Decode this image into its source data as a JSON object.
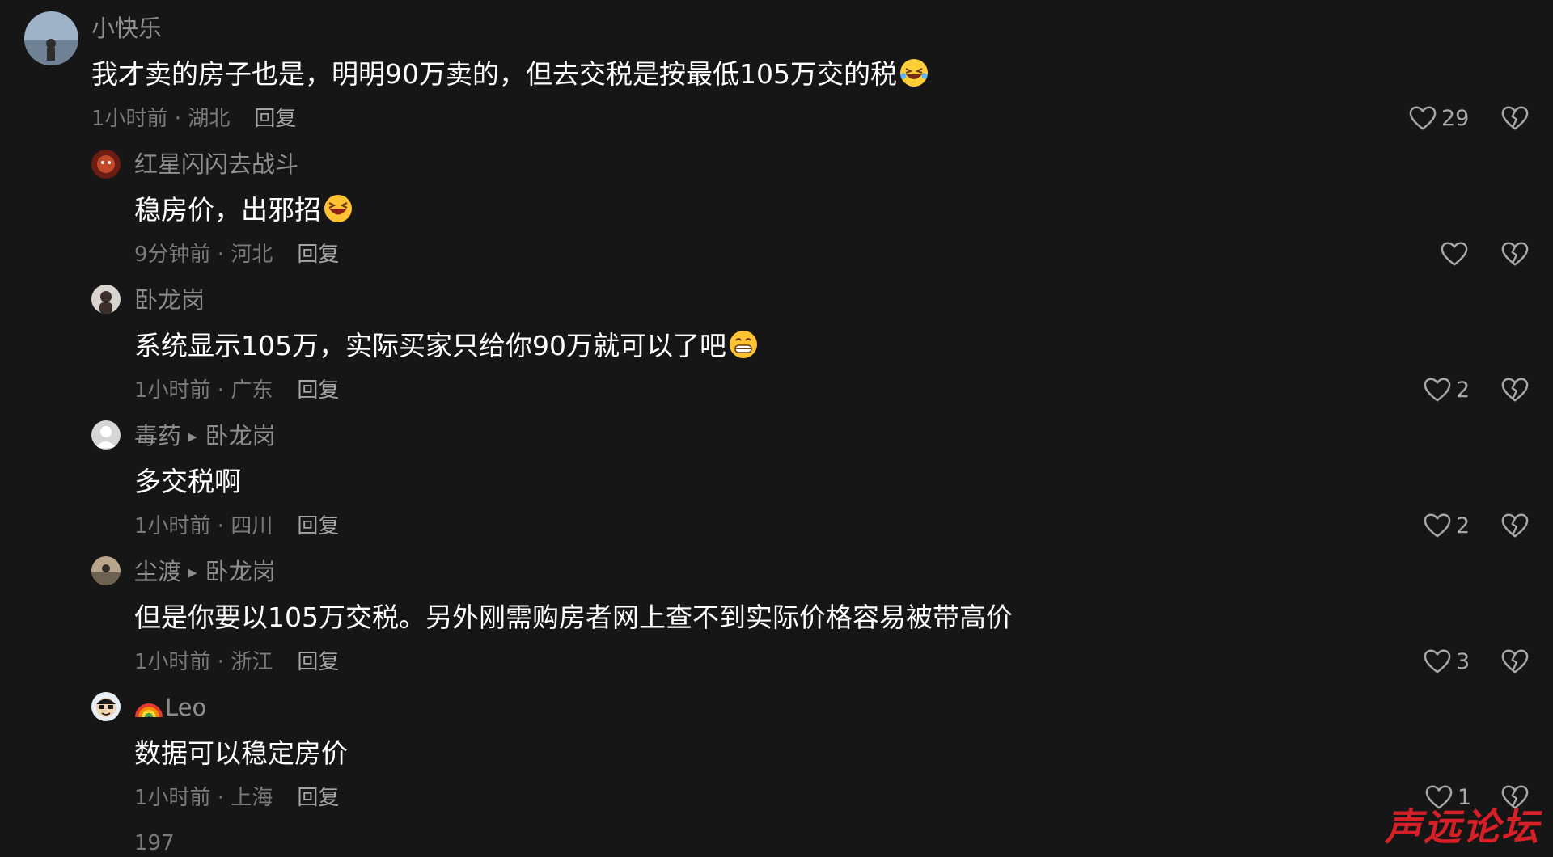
{
  "comments": [
    {
      "user": "小快乐",
      "text": "我才卖的房子也是，明明90万卖的，但去交税是按最低105万交的税",
      "emoji": "rofl",
      "time": "1小时前 · 湖北",
      "reply_label": "回复",
      "likes": "29"
    },
    {
      "user": "红星闪闪去战斗",
      "text": "稳房价，出邪招",
      "emoji": "laugh",
      "time": "9分钟前 · 河北",
      "reply_label": "回复",
      "likes": ""
    },
    {
      "user": "卧龙岗",
      "text": "系统显示105万，实际买家只给你90万就可以了吧",
      "emoji": "grin",
      "time": "1小时前 · 广东",
      "reply_label": "回复",
      "likes": "2"
    },
    {
      "user": "毒药",
      "reply_to": "卧龙岗",
      "text": "多交税啊",
      "time": "1小时前 · 四川",
      "reply_label": "回复",
      "likes": "2"
    },
    {
      "user": "尘渡",
      "reply_to": "卧龙岗",
      "text": "但是你要以105万交税。另外刚需购房者网上查不到实际价格容易被带高价",
      "time": "1小时前 · 浙江",
      "reply_label": "回复",
      "likes": "3"
    },
    {
      "user": "Leo",
      "user_prefix_icon": "rainbow-icon",
      "text": "数据可以稳定房价",
      "time": "1小时前 · 上海",
      "reply_label": "回复",
      "likes": "1"
    }
  ],
  "more_text": "197",
  "watermark": "声远论坛",
  "colors": {
    "background": "#161616",
    "text": "#ffffff",
    "secondary": "#8e8e8e",
    "watermark": "#d61f26"
  }
}
